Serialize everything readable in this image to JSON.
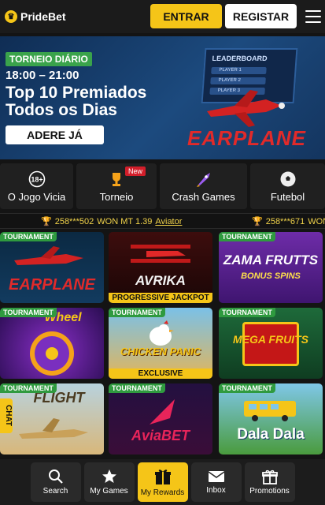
{
  "header": {
    "logo_text": "PrideBet",
    "login_label": "ENTRAR",
    "register_label": "REGISTAR"
  },
  "banner": {
    "tag": "TORNEIO DIÁRIO",
    "time": "18:00 – 21:00",
    "title_line1": "Top 10 Premiados",
    "title_line2": "Todos os Dias",
    "cta": "ADERE JÁ",
    "leaderboard_title": "LEADERBOARD",
    "players": [
      "PLAYER 1",
      "PLAYER 2",
      "PLAYER 3"
    ],
    "game_name": "EARPLANE"
  },
  "categories": [
    {
      "label": "O Jogo Vicia",
      "icon": "18-plus-icon"
    },
    {
      "label": "Torneio",
      "icon": "trophy-icon",
      "badge": "New"
    },
    {
      "label": "Crash Games",
      "icon": "rocket-icon"
    },
    {
      "label": "Futebol",
      "icon": "soccer-ball-icon"
    }
  ],
  "ticker": [
    {
      "user": "258***502",
      "text": "WON MT 1.39",
      "game": "Aviator"
    },
    {
      "user": "258***671",
      "text": "WON",
      "game": ""
    }
  ],
  "games": [
    {
      "name": "EARPLANE",
      "tag": "TOURNAMENT",
      "sub": ""
    },
    {
      "name": "AVRIKA",
      "tag": "",
      "sub": "PROGRESSIVE JACKPOT"
    },
    {
      "name": "ZAMA FRUTTS",
      "tag": "TOURNAMENT",
      "sub": "BONUS SPINS"
    },
    {
      "name": "Wheel",
      "tag": "TOURNAMENT",
      "sub": ""
    },
    {
      "name": "CHICKEN PANIC",
      "tag": "TOURNAMENT",
      "sub": "EXCLUSIVE"
    },
    {
      "name": "MEGA FRUITS",
      "tag": "TOURNAMENT",
      "sub": ""
    },
    {
      "name": "FLIGHT",
      "tag": "TOURNAMENT",
      "sub": ""
    },
    {
      "name": "AviaBET",
      "tag": "TOURNAMENT",
      "sub": ""
    },
    {
      "name": "Dala Dala",
      "tag": "TOURNAMENT",
      "sub": ""
    }
  ],
  "chat_label": "CHAT",
  "bottom_nav": [
    {
      "label": "Search",
      "icon": "search-icon"
    },
    {
      "label": "My Games",
      "icon": "star-icon"
    },
    {
      "label": "My Rewards",
      "icon": "gift-icon"
    },
    {
      "label": "Inbox",
      "icon": "mail-icon"
    },
    {
      "label": "Promotions",
      "icon": "present-icon"
    }
  ],
  "colors": {
    "accent": "#f5c518",
    "tag_green": "#2f9a3f",
    "bg": "#141414"
  }
}
